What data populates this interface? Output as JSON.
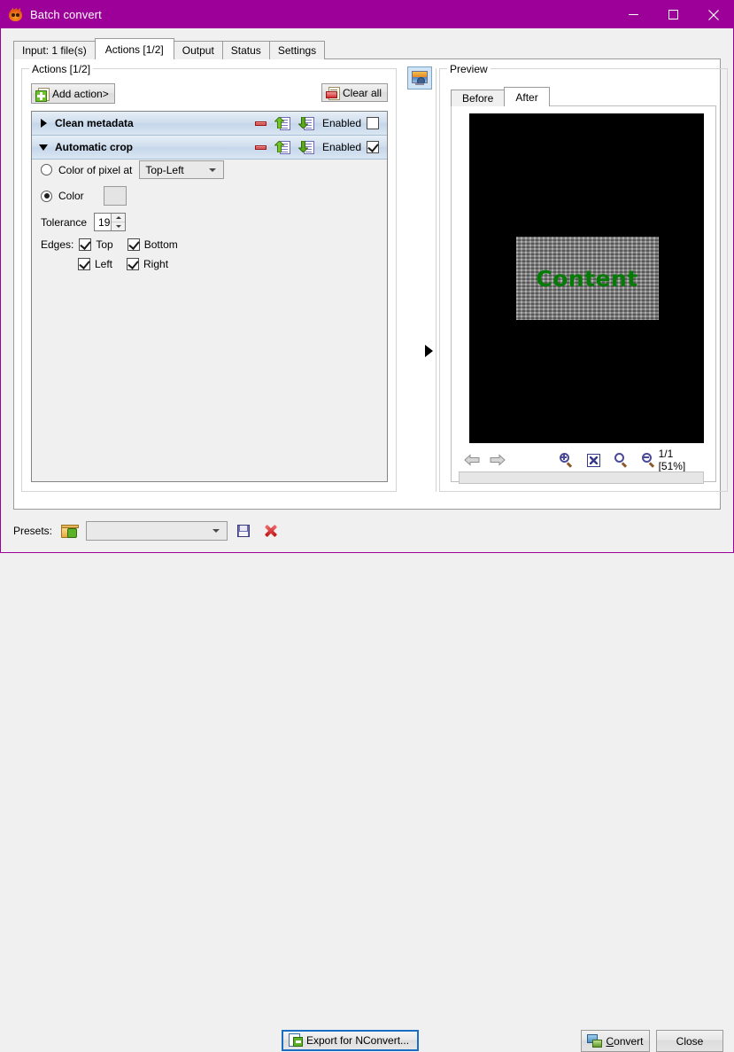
{
  "window": {
    "title": "Batch convert",
    "app_icon": "flame-icon",
    "minimize_label": "Minimize",
    "maximize_label": "Maximize",
    "close_label": "Close",
    "titlebar_color": "#9c0099"
  },
  "tabs": [
    {
      "label": "Input: 1 file(s)",
      "active": false
    },
    {
      "label": "Actions [1/2]",
      "active": true
    },
    {
      "label": "Output",
      "active": false
    },
    {
      "label": "Status",
      "active": false
    },
    {
      "label": "Settings",
      "active": false
    }
  ],
  "actions_group": {
    "title": "Actions [1/2]",
    "add_action_label": "Add action>",
    "clear_all_label": "Clear all",
    "rows": [
      {
        "name": "Clean metadata",
        "expanded": false,
        "enabled_label": "Enabled",
        "enabled": false
      },
      {
        "name": "Automatic crop",
        "expanded": true,
        "enabled_label": "Enabled",
        "enabled": true
      }
    ],
    "crop_options": {
      "pixel_radio_label": "Color of pixel at",
      "pixel_selected": false,
      "pixel_position_value": "Top-Left",
      "color_radio_label": "Color",
      "color_selected": true,
      "color_value": "#000000",
      "tolerance_label": "Tolerance",
      "tolerance_value": "19",
      "edges_label": "Edges:",
      "edges": [
        {
          "label": "Top",
          "checked": true
        },
        {
          "label": "Bottom",
          "checked": true
        },
        {
          "label": "Left",
          "checked": true
        },
        {
          "label": "Right",
          "checked": true
        }
      ]
    }
  },
  "preview": {
    "toggle_icon": "picture-icon",
    "title": "Preview",
    "tabs": [
      {
        "label": "Before",
        "active": false
      },
      {
        "label": "After",
        "active": true
      }
    ],
    "image": {
      "background_color": "#000000",
      "content_text": "Content",
      "content_text_color": "#067a06",
      "content_bg_color": "#8c8c8c"
    },
    "toolbar": {
      "prev_icon": "arrow-left-icon",
      "next_icon": "arrow-right-icon",
      "zoom_in_icon": "zoom-in-icon",
      "fit_icon": "fit-to-window-icon",
      "zoom_actual_icon": "zoom-actual-icon",
      "zoom_out_icon": "zoom-out-icon",
      "page_zoom_status": "1/1 [51%]"
    },
    "expander_icon": "expander-right-icon"
  },
  "bottom": {
    "presets_label": "Presets:",
    "open_preset_icon": "folder-open-icon",
    "presets_value": "",
    "save_preset_icon": "save-icon",
    "delete_preset_icon": "delete-icon",
    "export_label": "Export for NConvert...",
    "convert_label_pre": "C",
    "convert_label_post": "onvert",
    "close_label": "Close"
  }
}
